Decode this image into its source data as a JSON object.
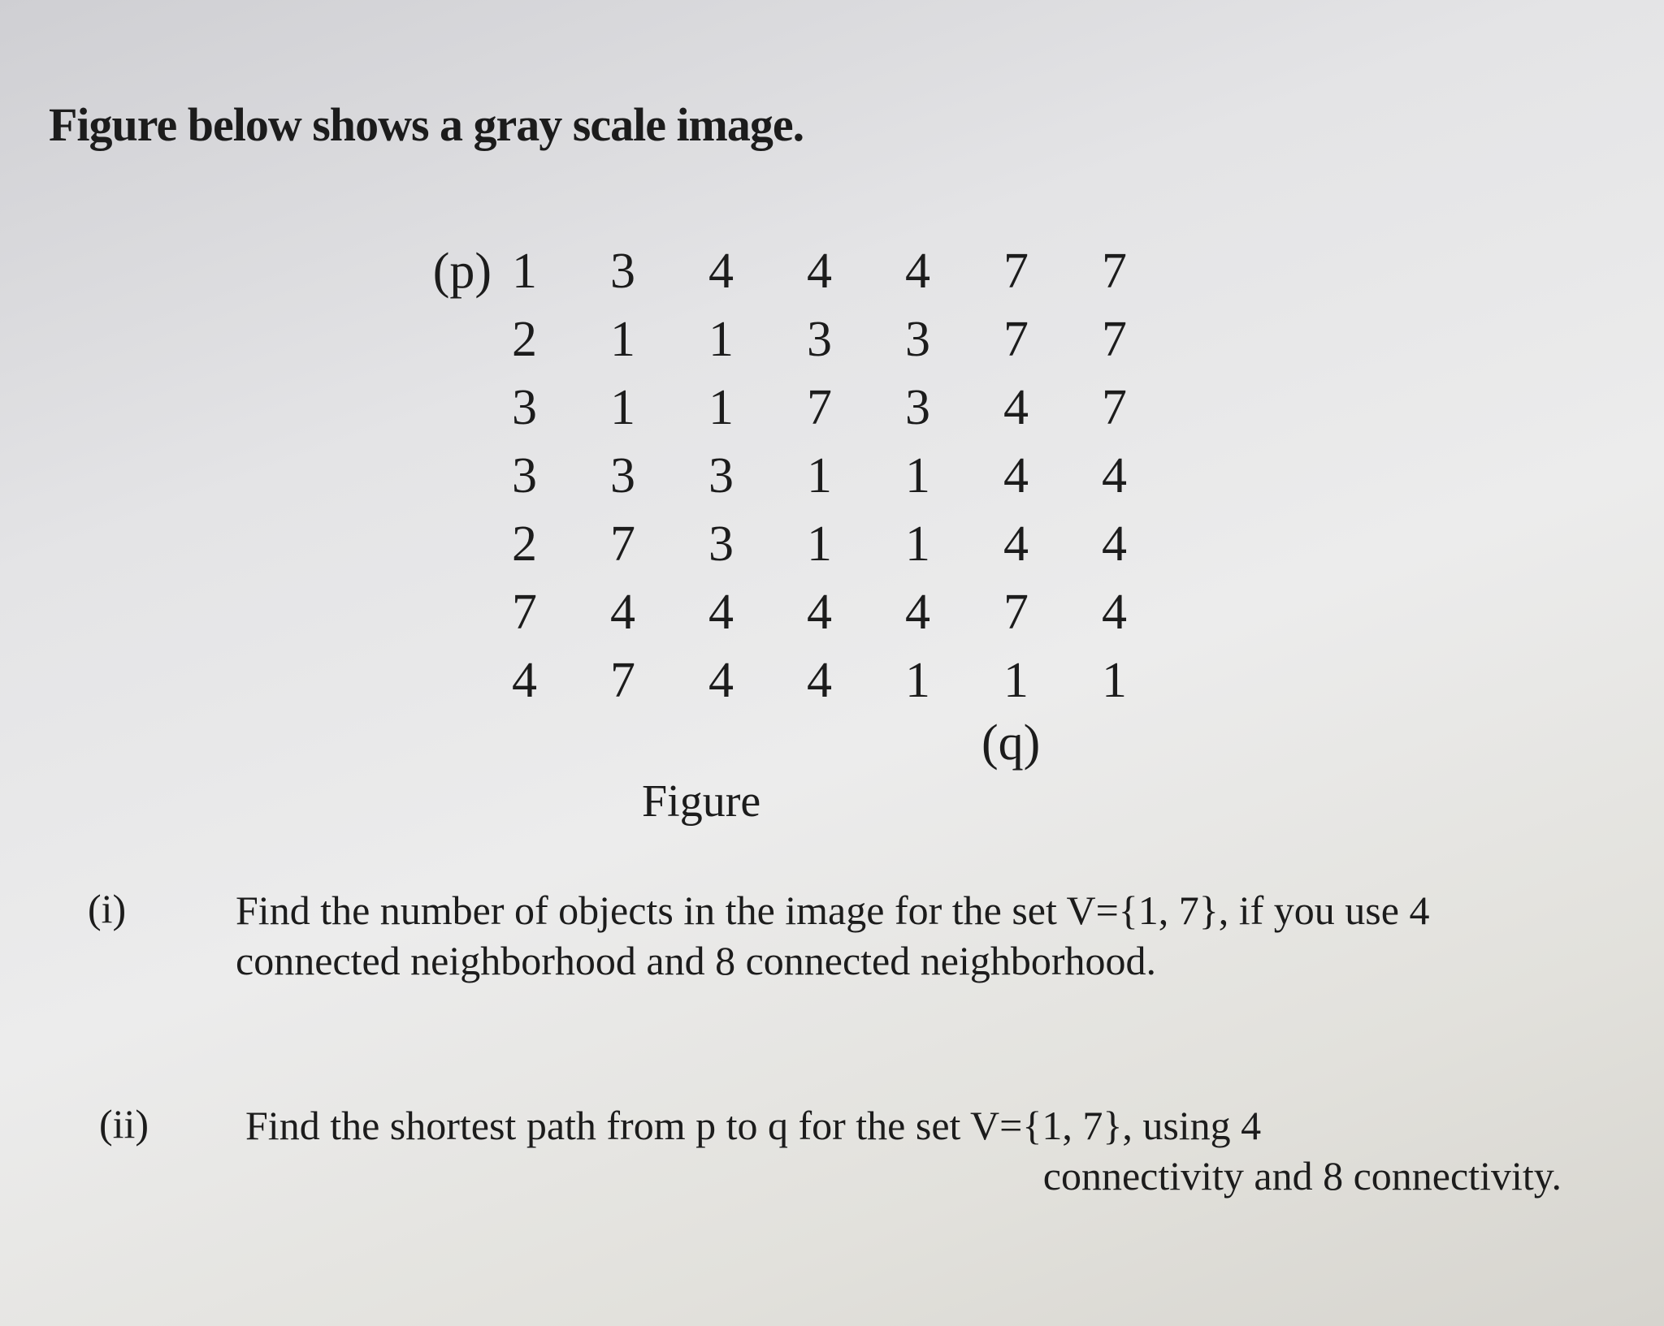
{
  "intro": "Figure below shows a gray scale image.",
  "matrix": {
    "rows": [
      [
        1,
        3,
        4,
        4,
        4,
        7,
        7
      ],
      [
        2,
        1,
        1,
        3,
        3,
        7,
        7
      ],
      [
        3,
        1,
        1,
        7,
        3,
        4,
        7
      ],
      [
        3,
        3,
        3,
        1,
        1,
        4,
        4
      ],
      [
        2,
        7,
        3,
        1,
        1,
        4,
        4
      ],
      [
        7,
        4,
        4,
        4,
        4,
        7,
        4
      ],
      [
        4,
        7,
        4,
        4,
        1,
        1,
        1
      ]
    ],
    "p_label": "(p)",
    "q_label": "(q)"
  },
  "caption": "Figure",
  "questions": [
    {
      "number": "(i)",
      "text": "Find the number of objects in the image for the set V={1, 7}, if you use 4 connected neighborhood and 8 connected neighborhood."
    },
    {
      "number": "(ii)",
      "line1": "Find the shortest path from p to q for the set V={1, 7}, using 4",
      "line2": "connectivity and 8 connectivity."
    }
  ]
}
